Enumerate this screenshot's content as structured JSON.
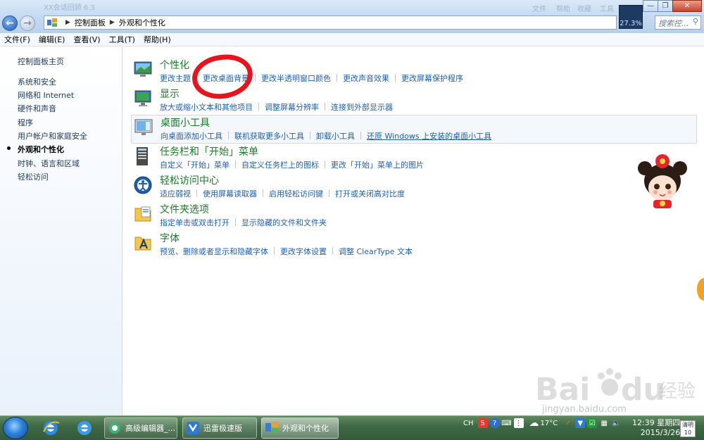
{
  "window": {
    "faint_title": "XX会话回顾 6.3",
    "faint_menus": [
      "文件",
      "帮助",
      "收藏",
      "工具"
    ],
    "address": {
      "crumbs": [
        "控制面板",
        "外观和个性化"
      ]
    },
    "cpu_percent": "27.3%",
    "search_placeholder": "搜索控..."
  },
  "menubar": [
    "文件(F)",
    "编辑(E)",
    "查看(V)",
    "工具(T)",
    "帮助(H)"
  ],
  "sidebar": {
    "items": [
      {
        "label": "控制面板主页"
      },
      {
        "label": "系统和安全"
      },
      {
        "label": "网络和 Internet"
      },
      {
        "label": "硬件和声音"
      },
      {
        "label": "程序"
      },
      {
        "label": "用户帐户和家庭安全"
      },
      {
        "label": "外观和个性化",
        "active": true
      },
      {
        "label": "时钟、语言和区域"
      },
      {
        "label": "轻松访问"
      }
    ]
  },
  "categories": [
    {
      "title": "个性化",
      "icon": "personalization-icon",
      "links": [
        "更改主题",
        "更改桌面背景",
        "更改半透明窗口颜色",
        "更改声音效果",
        "更改屏幕保护程序"
      ]
    },
    {
      "title": "显示",
      "icon": "display-icon",
      "links": [
        "放大或缩小文本和其他项目",
        "调整屏幕分辨率",
        "连接到外部显示器"
      ]
    },
    {
      "title": "桌面小工具",
      "icon": "gadgets-icon",
      "links": [
        "向桌面添加小工具",
        "联机获取更多小工具",
        "卸载小工具",
        "还原 Windows 上安装的桌面小工具"
      ]
    },
    {
      "title": "任务栏和「开始」菜单",
      "icon": "taskbar-icon",
      "links": [
        "自定义「开始」菜单",
        "自定义任务栏上的图标",
        "更改「开始」菜单上的图片"
      ]
    },
    {
      "title": "轻松访问中心",
      "icon": "ease-of-access-icon",
      "links": [
        "适应弱视",
        "使用屏幕读取器",
        "启用轻松访问键",
        "打开或关闭高对比度"
      ]
    },
    {
      "title": "文件夹选项",
      "icon": "folder-options-icon",
      "links": [
        "指定单击或双击打开",
        "显示隐藏的文件和文件夹"
      ]
    },
    {
      "title": "字体",
      "icon": "fonts-icon",
      "links": [
        "预览、删除或者显示和隐藏字体",
        "更改字体设置",
        "调整 ClearType 文本"
      ]
    }
  ],
  "watermark": {
    "site": "jingyan.baidu.com"
  },
  "taskbar": {
    "buttons": [
      "高级编辑器_...",
      "迅雷极速版",
      "外观和个性化"
    ],
    "tray": {
      "lang": "CH",
      "temp": "17°C"
    },
    "clock": {
      "time": "12:39 星期四",
      "date": "2015/3/26"
    },
    "weather": {
      "line1": "清明",
      "line2": "10"
    }
  },
  "colors": {
    "accent_link": "#1e5eb8",
    "category_title": "#1a7b27",
    "highlight_circle": "#e8141c"
  }
}
